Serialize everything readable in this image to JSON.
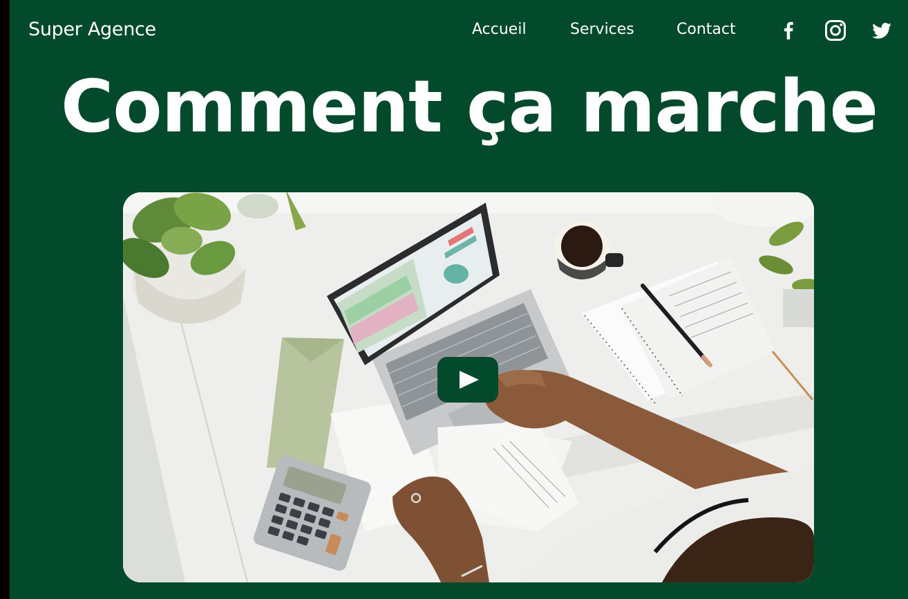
{
  "header": {
    "brand": "Super Agence",
    "nav": [
      {
        "label": "Accueil"
      },
      {
        "label": "Services"
      },
      {
        "label": "Contact"
      }
    ],
    "social": [
      {
        "icon": "facebook-icon"
      },
      {
        "icon": "instagram-icon"
      },
      {
        "icon": "twitter-icon"
      }
    ]
  },
  "hero": {
    "title": "Comment ça marche"
  },
  "video": {
    "play_icon": "play-icon"
  },
  "colors": {
    "background": "#03492b",
    "text": "#ffffff",
    "play_button": "#03492b"
  }
}
